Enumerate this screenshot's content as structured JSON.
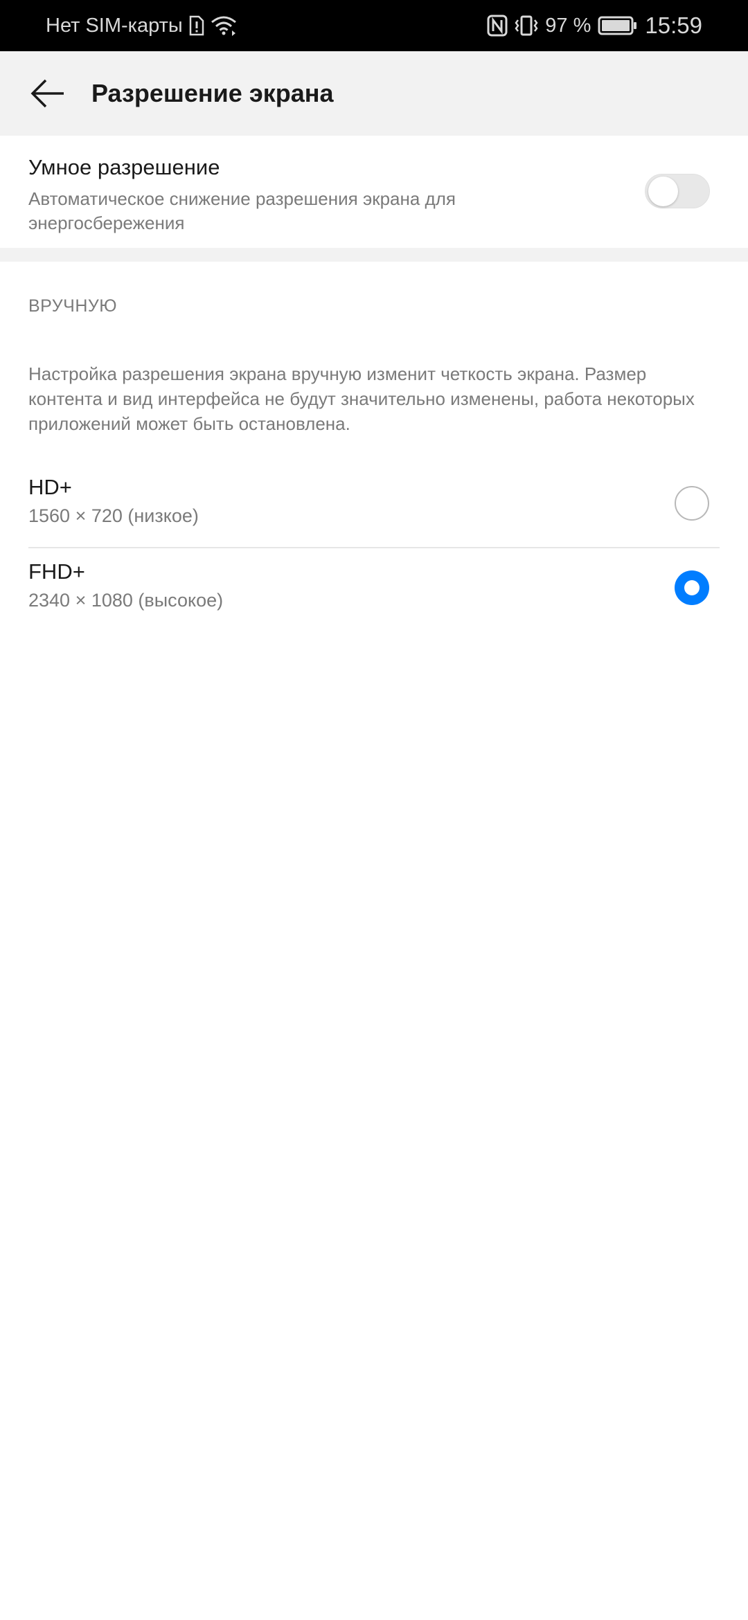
{
  "status_bar": {
    "carrier": "Нет SIM-карты",
    "battery": "97 %",
    "time": "15:59",
    "icons": [
      "sim-alert-icon",
      "wifi-icon",
      "nfc-icon",
      "vibrate-icon",
      "battery-icon"
    ]
  },
  "app_bar": {
    "back_icon": "arrow-back-icon",
    "title": "Разрешение экрана"
  },
  "smart_resolution": {
    "title": "Умное разрешение",
    "description": "Автоматическое снижение разрешения экрана для энергосбережения",
    "enabled": false
  },
  "manual": {
    "header": "ВРУЧНУЮ",
    "description": "Настройка разрешения экрана вручную изменит четкость экрана. Размер контента и вид интерфейса не будут значительно изменены, работа некоторых приложений может быть остановлена.",
    "options": [
      {
        "title": "HD+",
        "subtitle": "1560 × 720 (низкое)",
        "selected": false
      },
      {
        "title": "FHD+",
        "subtitle": "2340 × 1080 (высокое)",
        "selected": true
      }
    ]
  },
  "colors": {
    "accent": "#007dff",
    "status_bar_bg": "#000000",
    "app_bar_bg": "#f2f2f2"
  }
}
